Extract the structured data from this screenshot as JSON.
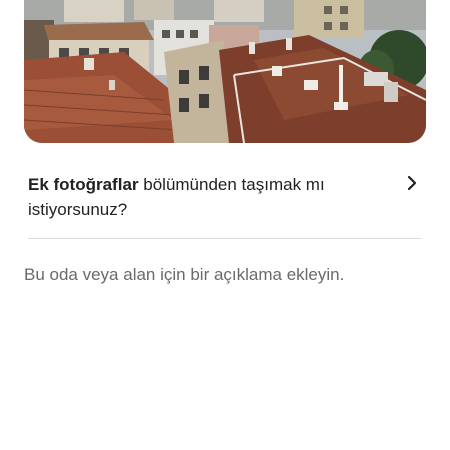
{
  "photo": {
    "icon": "rooftops-photo"
  },
  "move_prompt": {
    "bold_text": "Ek fotoğraflar",
    "rest_text": " bölümünden taşımak mı istiyorsunuz?",
    "icon": "chevron-right-icon"
  },
  "description": {
    "placeholder": "Bu oda veya alan için bir açıklama ekleyin."
  },
  "colors": {
    "text": "#222222",
    "muted_text": "#6a6a6a",
    "divider": "#dddddd"
  }
}
